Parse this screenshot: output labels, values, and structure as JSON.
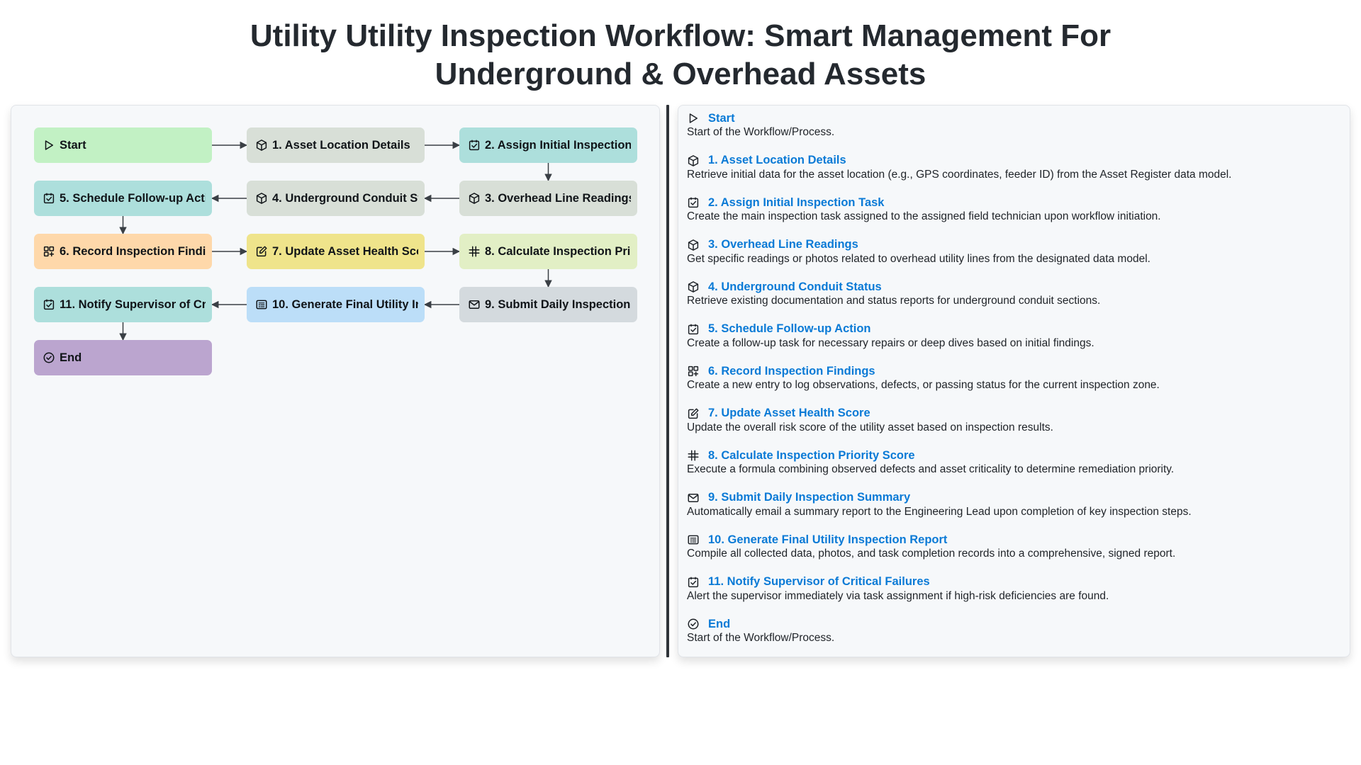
{
  "title": {
    "line1": "Utility Utility Inspection Workflow: Smart Management For",
    "line2": "Underground & Overhead Assets"
  },
  "nodes": [
    {
      "id": "start",
      "label": "Start",
      "icon": "play-icon",
      "color": "#c2f1c4"
    },
    {
      "id": "n1",
      "label": "1. Asset Location Details",
      "icon": "cube-icon",
      "color": "#d8dfd7"
    },
    {
      "id": "n2",
      "label": "2. Assign Initial Inspection Task",
      "icon": "checkbox-icon",
      "color": "#addfdc"
    },
    {
      "id": "n3",
      "label": "3. Overhead Line Readings",
      "icon": "cube-icon",
      "color": "#d8dfd7"
    },
    {
      "id": "n4",
      "label": "4. Underground Conduit Status",
      "icon": "cube-icon",
      "color": "#d8dfd7"
    },
    {
      "id": "n5",
      "label": "5. Schedule Follow-up Action",
      "icon": "checkbox-icon",
      "color": "#addfdc"
    },
    {
      "id": "n6",
      "label": "6. Record Inspection Findings",
      "icon": "grid-plus-icon",
      "color": "#fed8aa"
    },
    {
      "id": "n7",
      "label": "7. Update Asset Health Score",
      "icon": "edit-icon",
      "color": "#efe48b"
    },
    {
      "id": "n8",
      "label": "8. Calculate Inspection Priority Score",
      "icon": "hash-icon",
      "color": "#e2efc5"
    },
    {
      "id": "n9",
      "label": "9. Submit Daily Inspection Summary",
      "icon": "mail-icon",
      "color": "#d4dade"
    },
    {
      "id": "n10",
      "label": "10. Generate Final Utility Inspection Report",
      "icon": "report-icon",
      "color": "#bcdef8"
    },
    {
      "id": "n11",
      "label": "11. Notify Supervisor of Critical Failures",
      "icon": "checkbox-icon",
      "color": "#addfdc"
    },
    {
      "id": "end",
      "label": "End",
      "icon": "check-circle-icon",
      "color": "#bba5cf"
    }
  ],
  "legend": [
    {
      "name": "Start",
      "icon": "play-icon",
      "desc": "Start of the Workflow/Process."
    },
    {
      "name": "1. Asset Location Details",
      "icon": "cube-icon",
      "desc": "Retrieve initial data for the asset location (e.g., GPS coordinates, feeder ID) from the Asset Register data model."
    },
    {
      "name": "2. Assign Initial Inspection Task",
      "icon": "checkbox-icon",
      "desc": "Create the main inspection task assigned to the assigned field technician upon workflow initiation."
    },
    {
      "name": "3. Overhead Line Readings",
      "icon": "cube-icon",
      "desc": "Get specific readings or photos related to overhead utility lines from the designated data model."
    },
    {
      "name": "4. Underground Conduit Status",
      "icon": "cube-icon",
      "desc": "Retrieve existing documentation and status reports for underground conduit sections."
    },
    {
      "name": "5. Schedule Follow-up Action",
      "icon": "checkbox-icon",
      "desc": "Create a follow-up task for necessary repairs or deep dives based on initial findings."
    },
    {
      "name": "6. Record Inspection Findings",
      "icon": "grid-plus-icon",
      "desc": "Create a new entry to log observations, defects, or passing status for the current inspection zone."
    },
    {
      "name": "7. Update Asset Health Score",
      "icon": "edit-icon",
      "desc": "Update the overall risk score of the utility asset based on inspection results."
    },
    {
      "name": "8. Calculate Inspection Priority Score",
      "icon": "hash-icon",
      "desc": "Execute a formula combining observed defects and asset criticality to determine remediation priority."
    },
    {
      "name": "9. Submit Daily Inspection Summary",
      "icon": "mail-icon",
      "desc": "Automatically email a summary report to the Engineering Lead upon completion of key inspection steps."
    },
    {
      "name": "10. Generate Final Utility Inspection Report",
      "icon": "report-icon",
      "desc": "Compile all collected data, photos, and task completion records into a comprehensive, signed report."
    },
    {
      "name": "11. Notify Supervisor of Critical Failures",
      "icon": "checkbox-icon",
      "desc": "Alert the supervisor immediately via task assignment if high-risk deficiencies are found."
    },
    {
      "name": "End",
      "icon": "check-circle-icon",
      "desc": "Start of the Workflow/Process."
    }
  ],
  "colors": {
    "accent": "#0a7ad6",
    "edge": "#3a3f45"
  }
}
